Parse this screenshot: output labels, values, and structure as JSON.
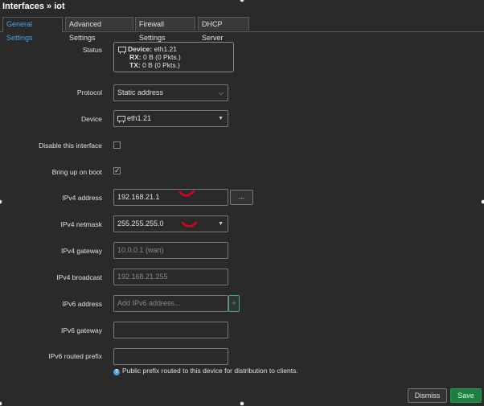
{
  "title": "Interfaces » iot",
  "tabs": [
    {
      "label": "General Settings",
      "active": true
    },
    {
      "label": "Advanced Settings",
      "active": false
    },
    {
      "label": "Firewall Settings",
      "active": false
    },
    {
      "label": "DHCP Server",
      "active": false
    }
  ],
  "status": {
    "label": "Status",
    "device_label": "Device:",
    "device_value": "eth1.21",
    "rx_label": "RX:",
    "rx_value": "0 B (0 Pkts.)",
    "tx_label": "TX:",
    "tx_value": "0 B (0 Pkts.)"
  },
  "protocol": {
    "label": "Protocol",
    "value": "Static address"
  },
  "device": {
    "label": "Device",
    "value": "eth1.21"
  },
  "disable_iface": {
    "label": "Disable this interface",
    "checked": false
  },
  "bring_up": {
    "label": "Bring up on boot",
    "checked": true,
    "check_glyph": "✓"
  },
  "ipv4_address": {
    "label": "IPv4 address",
    "value": "192.168.21.1",
    "more": "..."
  },
  "ipv4_netmask": {
    "label": "IPv4 netmask",
    "value": "255.255.255.0"
  },
  "ipv4_gateway": {
    "label": "IPv4 gateway",
    "placeholder": "10.0.0.1 (wan)"
  },
  "ipv4_broadcast": {
    "label": "IPv4 broadcast",
    "placeholder": "192.168.21.255"
  },
  "ipv6_address": {
    "label": "IPv6 address",
    "placeholder": "Add IPv6 address...",
    "add": "+"
  },
  "ipv6_gateway": {
    "label": "IPv6 gateway",
    "value": ""
  },
  "ipv6_prefix": {
    "label": "IPv6 routed prefix",
    "value": "",
    "help_icon": "?",
    "help": "Public prefix routed to this device for distribution to clients."
  },
  "buttons": {
    "dismiss": "Dismiss",
    "save": "Save"
  },
  "colors": {
    "accent": "#4aa3df",
    "save": "#1e7f3f",
    "annotation": "#e0001b"
  },
  "icons": [
    "network-port-icon",
    "chevron-down-icon",
    "caret-down-icon",
    "checkmark-icon",
    "help-icon"
  ]
}
